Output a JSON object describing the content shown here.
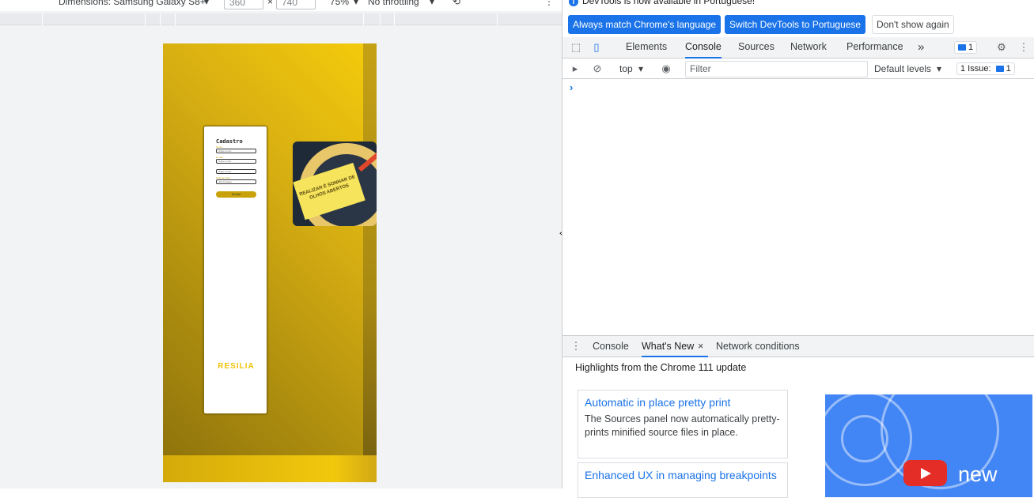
{
  "emulation": {
    "dimensions_label": "Dimensions: Samsung Galaxy S8+",
    "width": "360",
    "height": "740",
    "zoom": "75%",
    "throttling": "No throttling"
  },
  "page": {
    "form_title": "Cadastro",
    "fields": [
      {
        "label": "Nome",
        "placeholder": "Digite nome:"
      },
      {
        "label": "E-mail",
        "placeholder": "Digite email:"
      },
      {
        "label": "",
        "placeholder": "Digite email:"
      },
      {
        "label": "Data de nasc.",
        "placeholder": "dd/mm/aaaa"
      }
    ],
    "submit_label": "Enviar",
    "brand": "RESILIA",
    "poster_text": "REALIZAR É SONHAR DE OLHOS ABERTOS"
  },
  "devtools": {
    "notice": "DevTools is now available in Portuguese!",
    "btn_match": "Always match Chrome's language",
    "btn_switch": "Switch DevTools to Portuguese",
    "btn_dont": "Don't show again",
    "tabs": [
      "Elements",
      "Console",
      "Sources",
      "Network",
      "Performance"
    ],
    "more_tabs": "»",
    "messages_count": "1",
    "context": "top",
    "filter_placeholder": "Filter",
    "levels": "Default levels",
    "issues": "1 Issue:",
    "issues_count": "1",
    "prompt": "›",
    "drawer_tabs": [
      "Console",
      "What's New",
      "Network conditions"
    ],
    "drawer_close": "×",
    "drawer_heading": "Highlights from the Chrome 111 update",
    "cards": [
      {
        "title": "Automatic in place pretty print",
        "desc": "The Sources panel now automatically pretty-prints minified source files in place."
      },
      {
        "title": "Enhanced UX in managing breakpoints",
        "desc": ""
      }
    ],
    "video_text": "new",
    "colors": {
      "accent": "#1a73e8",
      "yellow": "#f5cc0b"
    }
  }
}
